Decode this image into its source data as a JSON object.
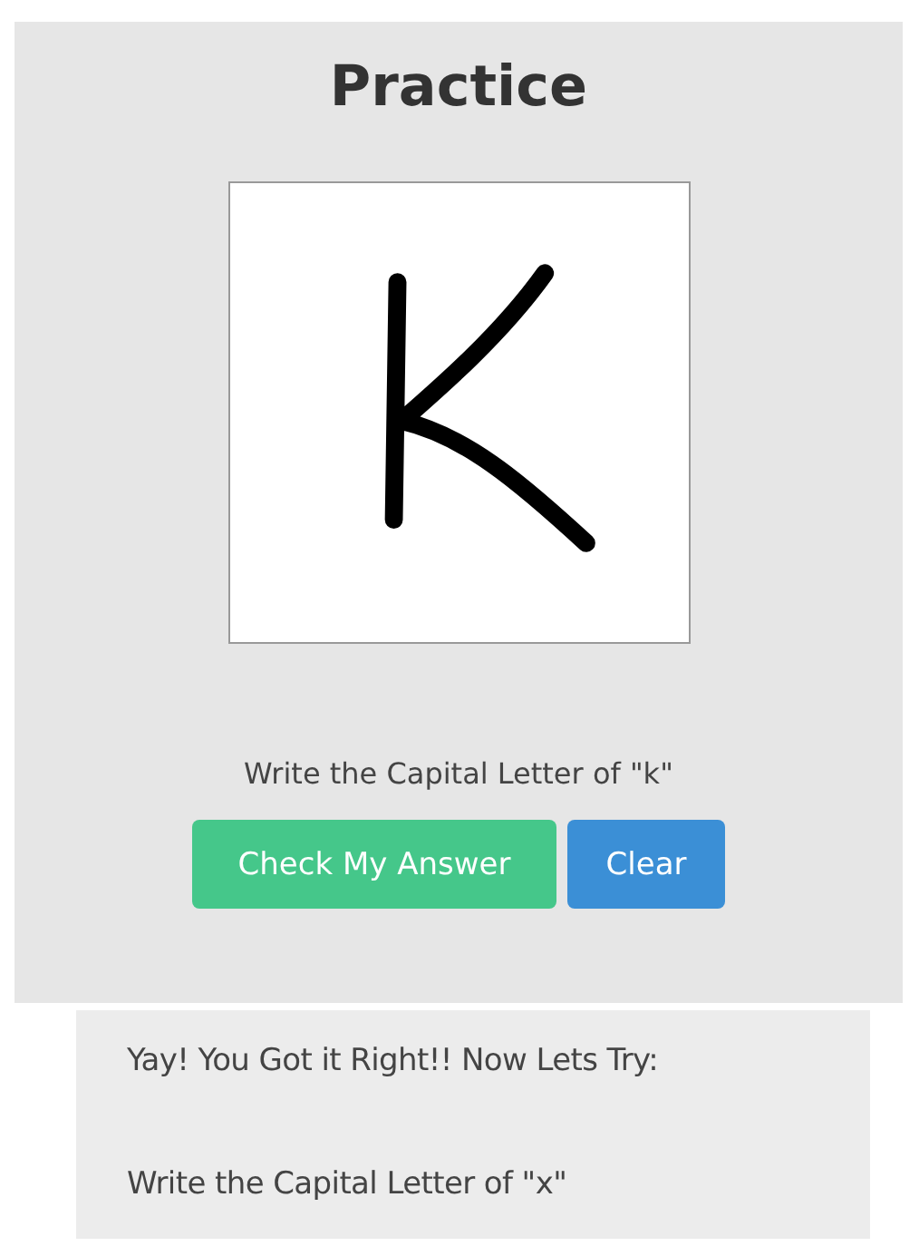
{
  "title": "Practice",
  "prompt": "Write the Capital Letter of \"k\"",
  "buttons": [
    {
      "label": "Check My Answer",
      "kind": "primary"
    },
    {
      "label": "Clear",
      "kind": "secondary"
    }
  ],
  "feedback": {
    "message": "Yay! You Got it Right!! Now Lets Try:",
    "next_prompt": "Write the Capital Letter of \"x\""
  }
}
